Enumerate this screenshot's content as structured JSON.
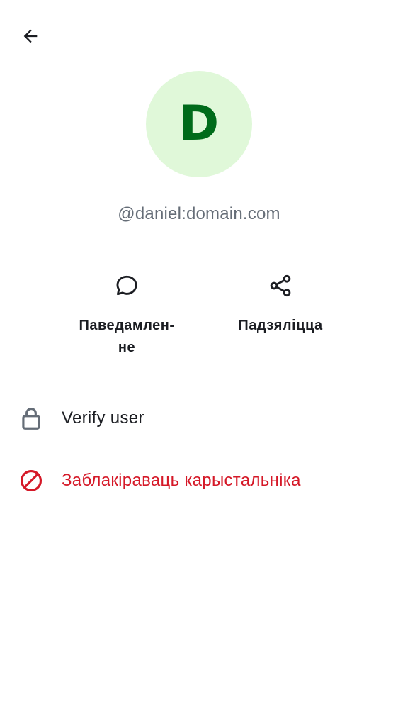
{
  "header": {
    "back_icon": "arrow-back-icon"
  },
  "profile": {
    "avatar_letter": "D",
    "user_id": "@daniel:domain.com"
  },
  "actions": {
    "message": {
      "label": "Паведамлен-\nне",
      "icon": "chat-bubble-icon"
    },
    "share": {
      "label": "Падзяліцца",
      "icon": "share-icon"
    }
  },
  "list": {
    "verify": {
      "label": "Verify user",
      "icon": "lock-icon"
    },
    "block": {
      "label": "Заблакіраваць карыстальніка",
      "icon": "block-icon"
    }
  },
  "colors": {
    "avatar_bg": "#e0f8d9",
    "avatar_text": "#006b1a",
    "primary_text": "#1b1d22",
    "secondary_text": "#656d77",
    "icon_gray": "#656d77",
    "critical": "#d51928"
  }
}
